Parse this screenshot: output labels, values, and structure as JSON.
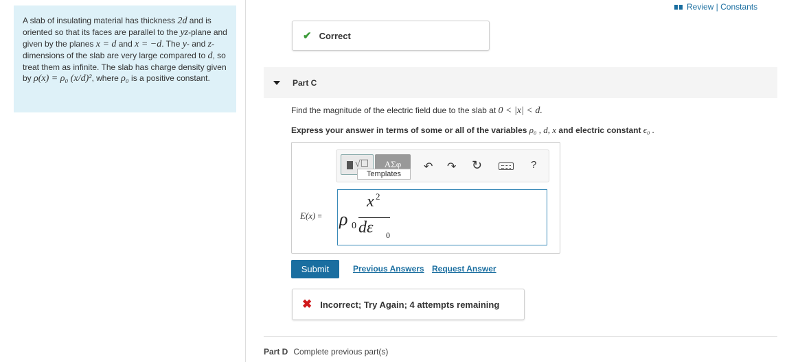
{
  "problem": {
    "segments": [
      {
        "t": "A slab of insulating material has thickness "
      },
      {
        "m": "2d"
      },
      {
        "t": " and is oriented so that its faces are parallel to the "
      },
      {
        "m": "yz"
      },
      {
        "t": "-plane and given by the planes "
      },
      {
        "m": "x = d"
      },
      {
        "t": " and "
      },
      {
        "m": "x = −d"
      },
      {
        "t": ". The "
      },
      {
        "m": "y"
      },
      {
        "t": "- and "
      },
      {
        "m": "z"
      },
      {
        "t": "-dimensions of the slab are very large compared to "
      },
      {
        "m": "d"
      },
      {
        "t": ", so treat them as infinite. The slab has charge density given by "
      },
      {
        "m": "ρ(x) = ρ₀ (x/d)²"
      },
      {
        "t": ", where "
      },
      {
        "m": "ρ₀"
      },
      {
        "t": " is a positive constant."
      }
    ]
  },
  "review_links": "Review | Constants",
  "previous_part_feedback": {
    "status": "Correct"
  },
  "part_c": {
    "title": "Part C",
    "question_prefix": "Find the magnitude of the electric field due to the slab at ",
    "question_math": "0 < |x| < d.",
    "express_prefix": "Express your answer in terms of some or all of the variables ",
    "express_vars": "ρ₀ , d, x",
    "express_and": " and electric constant ",
    "express_const": "ϵ₀ ."
  },
  "toolbar": {
    "templates_tooltip": "Templates",
    "symbols_label": "ΑΣφ",
    "help_label": "?"
  },
  "answer": {
    "label_math": "E(x)",
    "label_equals": " =",
    "rho": "ρ",
    "rho_sub": "0",
    "numerator": "x",
    "numerator_sup": "2",
    "denominator": "dε",
    "denominator_sub": "0"
  },
  "actions": {
    "submit_label": "Submit",
    "previous_answers_label": "Previous Answers",
    "request_answer_label": "Request Answer"
  },
  "feedback": {
    "status": "Incorrect; Try Again; 4 attempts remaining"
  },
  "part_d": {
    "title": "Part D",
    "status": "Complete previous part(s)"
  },
  "colors": {
    "accent": "#1a6ea0",
    "correct": "#3c9b3a",
    "incorrect": "#d0191b",
    "problem_bg": "#def1f8"
  },
  "icons": [
    "review-icon",
    "check-icon",
    "caret-down-icon",
    "undo-icon",
    "redo-icon",
    "reset-icon",
    "keyboard-icon",
    "help-icon",
    "x-icon"
  ]
}
